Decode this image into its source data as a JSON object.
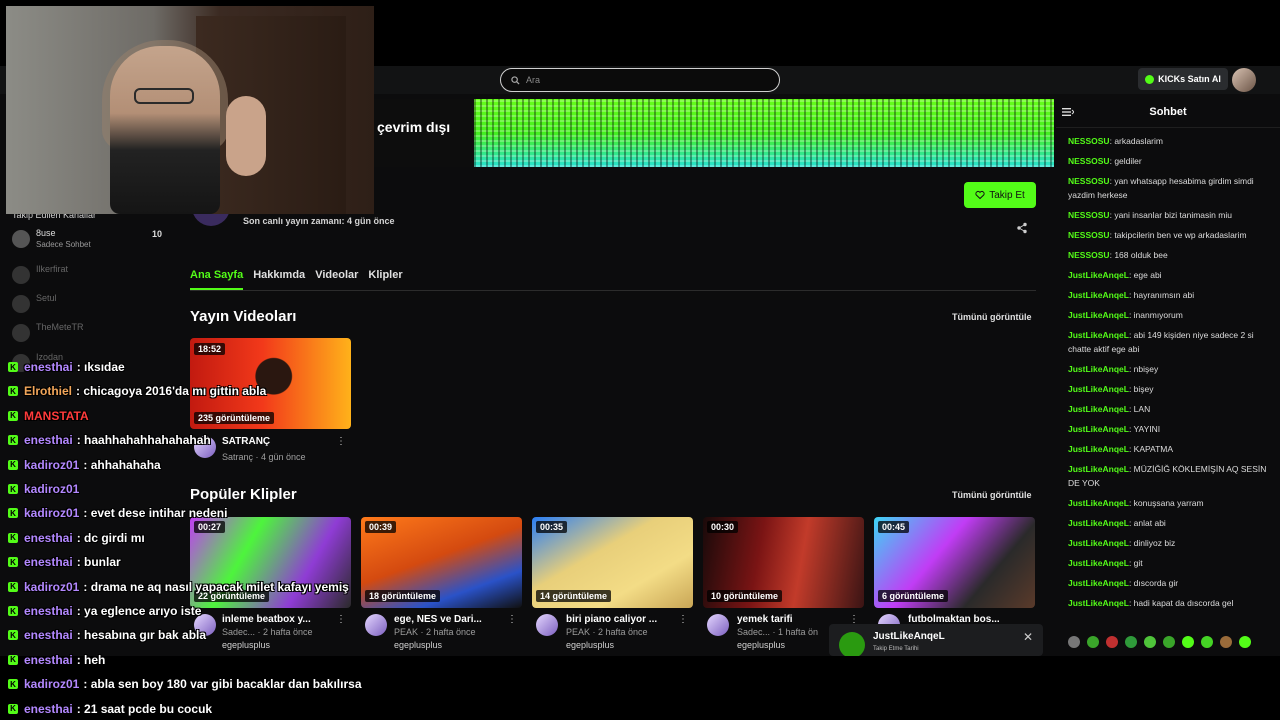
{
  "search": {
    "placeholder": "Ara"
  },
  "topbar": {
    "kicks_label": "KICKs Satın Al"
  },
  "banner": {
    "offline_label": "çevrim dışı"
  },
  "channel": {
    "follow_label": "Takip Et",
    "last_live": "Son canlı yayın zamanı: 4 gün önce"
  },
  "tabs": [
    {
      "label": "Ana Sayfa"
    },
    {
      "label": "Hakkımda"
    },
    {
      "label": "Videolar"
    },
    {
      "label": "Klipler"
    }
  ],
  "videos_section": {
    "title": "Yayın Videoları",
    "see_all": "Tümünü görüntüle",
    "items": [
      {
        "duration": "18:52",
        "views": "235 görüntüleme",
        "title": "SATRANÇ",
        "subtitle": "Satranç · 4 gün önce"
      }
    ]
  },
  "clips_section": {
    "title": "Popüler Klipler",
    "see_all": "Tümünü görüntüle",
    "items": [
      {
        "duration": "00:27",
        "views": "22 görüntüleme",
        "title": "inleme beatbox y...",
        "subtitle": "Sadec... · 2 hafta önce",
        "user": "egeplusplus"
      },
      {
        "duration": "00:39",
        "views": "18 görüntüleme",
        "title": "ege, NES ve Dari...",
        "subtitle": "PEAK · 2 hafta önce",
        "user": "egeplusplus"
      },
      {
        "duration": "00:35",
        "views": "14 görüntüleme",
        "title": "biri piano caliyor ...",
        "subtitle": "PEAK · 2 hafta önce",
        "user": "egeplusplus"
      },
      {
        "duration": "00:30",
        "views": "10 görüntüleme",
        "title": "yemek tarifi",
        "subtitle": "Sadec... · 1 hafta ön",
        "user": "egeplusplus"
      },
      {
        "duration": "00:45",
        "views": "6 görüntüleme",
        "title": "futbolmaktan bos...",
        "subtitle": "",
        "user": ""
      }
    ]
  },
  "sidebar": {
    "title": "Takip Edilen Kanallar",
    "items": [
      {
        "name": "8use",
        "category": "Sadece Sohbet",
        "viewers": "10"
      },
      {
        "name": "Ilkerfirat",
        "category": "",
        "viewers": ""
      },
      {
        "name": "Setul",
        "category": "",
        "viewers": ""
      },
      {
        "name": "TheMeteTR",
        "category": "",
        "viewers": ""
      },
      {
        "name": "Izodan",
        "category": "",
        "viewers": ""
      }
    ]
  },
  "toast": {
    "name": "JustLikeAnqeL",
    "subtitle": "Takip Etme Tarihi"
  },
  "chat": {
    "title": "Sohbet",
    "colors": {
      "nessosu": "#53fc18",
      "justlike": "#53fc18"
    },
    "messages": [
      {
        "user": "NESSOSU",
        "text": "arkadaslarim"
      },
      {
        "user": "NESSOSU",
        "text": "geldiler"
      },
      {
        "user": "NESSOSU",
        "text": "yan whatsapp hesabima girdim simdi yazdim herkese"
      },
      {
        "user": "NESSOSU",
        "text": "yani insanlar bizi tanimasin miu"
      },
      {
        "user": "NESSOSU",
        "text": "takipcilerin ben ve wp arkadaslarim"
      },
      {
        "user": "NESSOSU",
        "text": "168 olduk bee"
      },
      {
        "user": "JustLikeAnqeL",
        "text": "ege abi"
      },
      {
        "user": "JustLikeAnqeL",
        "text": "hayranımsın abi"
      },
      {
        "user": "JustLikeAnqeL",
        "text": "inanmıyorum"
      },
      {
        "user": "JustLikeAnqeL",
        "text": "abi 149 kişiden niye sadece 2 si chatte aktif ege abi"
      },
      {
        "user": "JustLikeAnqeL",
        "text": "nbişey"
      },
      {
        "user": "JustLikeAnqeL",
        "text": "bişey"
      },
      {
        "user": "JustLikeAnqeL",
        "text": "LAN"
      },
      {
        "user": "JustLikeAnqeL",
        "text": "YAYINI"
      },
      {
        "user": "JustLikeAnqeL",
        "text": "KAPATMA"
      },
      {
        "user": "JustLikeAnqeL",
        "text": "MÜZİĞİĞ KÖKLEMİŞİN AQ SESİN DE YOK"
      },
      {
        "user": "JustLikeAnqeL",
        "text": "konuşsana yarram"
      },
      {
        "user": "JustLikeAnqeL",
        "text": "anlat abi"
      },
      {
        "user": "JustLikeAnqeL",
        "text": "dinliyoz biz"
      },
      {
        "user": "JustLikeAnqeL",
        "text": "git"
      },
      {
        "user": "JustLikeAnqeL",
        "text": "dıscorda gir"
      },
      {
        "user": "JustLikeAnqeL",
        "text": "hadi kapat da dıscorda gel"
      }
    ]
  },
  "overlay_chat": [
    {
      "user": "enesthai",
      "text": "ıksıdae",
      "color": "#b388ff"
    },
    {
      "user": "Elrothiel",
      "text": "chicagoya 2016'da mı gittin abla",
      "color": "#f2a65a"
    },
    {
      "user": "MANSTATA",
      "text": "",
      "color": "#ff3b3b"
    },
    {
      "user": "enesthai",
      "text": "haahhahahhahahahah",
      "color": "#b388ff"
    },
    {
      "user": "kadiroz01",
      "text": "ahhahahaha",
      "color": "#b388ff"
    },
    {
      "user": "kadiroz01",
      "text": "",
      "color": "#b388ff"
    },
    {
      "user": "kadiroz01",
      "text": "evet dese intihar nedeni",
      "color": "#b388ff"
    },
    {
      "user": "enesthai",
      "text": "dc girdi mı",
      "color": "#b388ff"
    },
    {
      "user": "enesthai",
      "text": "bunlar",
      "color": "#b388ff"
    },
    {
      "user": "kadiroz01",
      "text": "drama ne aq nasıl yapacak milet kafayı yemiş",
      "color": "#b388ff"
    },
    {
      "user": "enesthai",
      "text": "ya eglence arıyo iste",
      "color": "#b388ff"
    },
    {
      "user": "enesthai",
      "text": "hesabına gır bak abla",
      "color": "#b388ff"
    },
    {
      "user": "enesthai",
      "text": "heh",
      "color": "#b388ff"
    },
    {
      "user": "kadiroz01",
      "text": "abla sen boy 180 var gibi bacaklar dan bakılırsa",
      "color": "#b388ff"
    },
    {
      "user": "enesthai",
      "text": "21 saat pcde bu cocuk",
      "color": "#b388ff"
    }
  ]
}
